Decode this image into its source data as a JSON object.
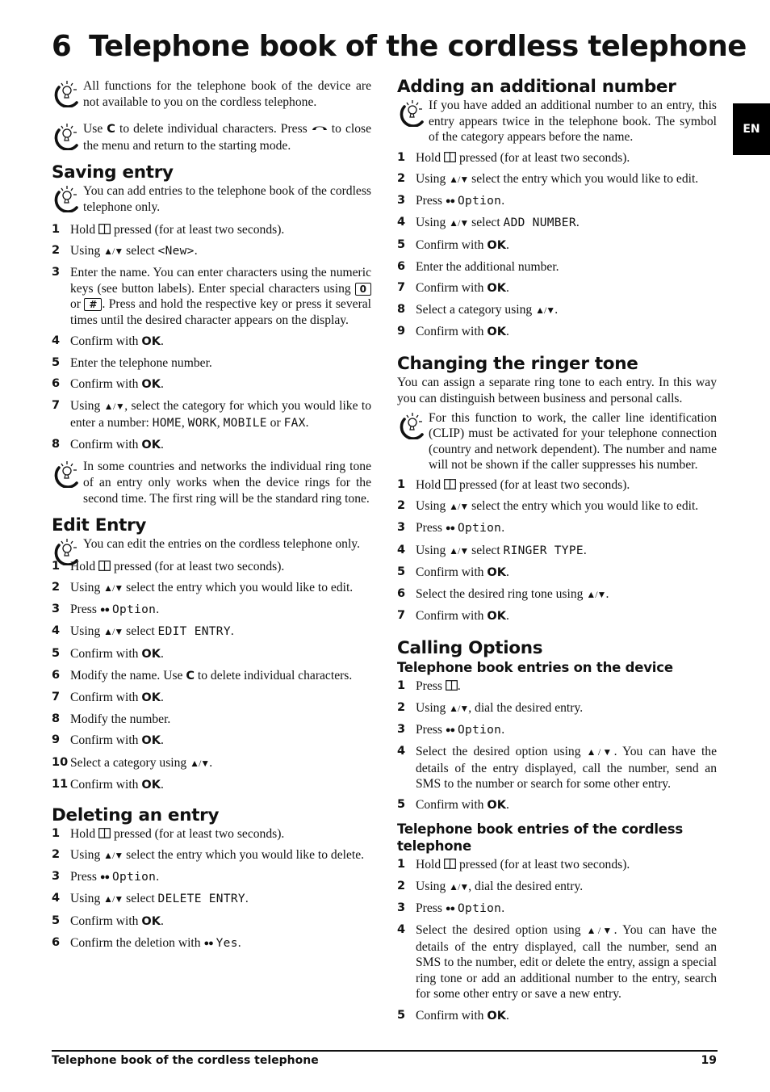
{
  "chapter": {
    "number": "6",
    "title": "Telephone book of the cordless telephone"
  },
  "language_tab": "EN",
  "icons": {
    "tip": "lightbulb-tip-icon",
    "phonebook": "phonebook-icon",
    "arrows": "up-down-arrows",
    "end_call": "end-call-icon",
    "softkey": "softkey-dots"
  },
  "glyphs": {
    "arrows": "▲/▼",
    "dots": "●●"
  },
  "intro_tips": [
    "All functions for the telephone book of the device are not available to you on the cordless telephone.",
    {
      "pre": "Use ",
      "key": "C",
      "mid": " to delete individual characters. Press ",
      "post": " to close the menu and return to the starting mode."
    }
  ],
  "saving_entry": {
    "heading": "Saving entry",
    "tip": "You can add entries to the telephone book of the cordless telephone only.",
    "steps": {
      "s1": {
        "n": "1",
        "pre": "Hold ",
        "post": " pressed (for at least two seconds)."
      },
      "s2": {
        "n": "2",
        "pre": "Using ",
        "mid": " select ",
        "lcd": "<New>",
        "post": "."
      },
      "s3": {
        "n": "3",
        "a": "Enter the name. You can enter characters using the numeric keys (see button labels).  Enter special characters using ",
        "k1": "0",
        "b": " or ",
        "k2": "#",
        "c": ". Press and hold the respective key or press it several times until the desired character appears on the display."
      },
      "s4": {
        "n": "4",
        "pre": "Confirm with ",
        "kb": "OK",
        "post": "."
      },
      "s5": {
        "n": "5",
        "text": "Enter the telephone number."
      },
      "s6": {
        "n": "6",
        "pre": "Confirm with ",
        "kb": "OK",
        "post": "."
      },
      "s7": {
        "n": "7",
        "pre": "Using ",
        "mid": ", select the category for which you would like to enter a number: ",
        "c1": "HOME",
        "c2": "WORK",
        "c3": "MOBILE",
        "or": " or ",
        "c4": "FAX",
        "post": "."
      },
      "s8": {
        "n": "8",
        "pre": "Confirm with ",
        "kb": "OK",
        "post": "."
      }
    },
    "tip2": "In some countries and networks the individual ring tone of an entry only works when the device rings for the second time. The first ring will be the standard ring tone."
  },
  "edit_entry": {
    "heading": "Edit Entry",
    "tip": "You can edit the entries on the cordless telephone only.",
    "steps": {
      "s1": {
        "n": "1",
        "pre": "Hold ",
        "post": " pressed (for at least two seconds)."
      },
      "s2": {
        "n": "2",
        "pre": "Using ",
        "post": " select the entry which you would like to edit."
      },
      "s3": {
        "n": "3",
        "pre": "Press ",
        "lcd": "Option",
        "post": "."
      },
      "s4": {
        "n": "4",
        "pre": "Using ",
        "mid": " select ",
        "lcd": "EDIT ENTRY",
        "post": "."
      },
      "s5": {
        "n": "5",
        "pre": "Confirm with ",
        "kb": "OK",
        "post": "."
      },
      "s6": {
        "n": "6",
        "pre": "Modify the name. Use ",
        "kb": "C",
        "post": " to delete individual characters."
      },
      "s7": {
        "n": "7",
        "pre": "Confirm with ",
        "kb": "OK",
        "post": "."
      },
      "s8": {
        "n": "8",
        "text": "Modify the number."
      },
      "s9": {
        "n": "9",
        "pre": "Confirm with ",
        "kb": "OK",
        "post": "."
      },
      "s10": {
        "n": "10",
        "pre": "Select a category using ",
        "post": "."
      },
      "s11": {
        "n": "11",
        "pre": "Confirm with ",
        "kb": "OK",
        "post": "."
      }
    }
  },
  "deleting_entry": {
    "heading": "Deleting an entry",
    "steps": {
      "s1": {
        "n": "1",
        "pre": "Hold ",
        "post": " pressed (for at least two seconds)."
      },
      "s2": {
        "n": "2",
        "pre": "Using ",
        "post": " select the entry which you would like to delete."
      },
      "s3": {
        "n": "3",
        "pre": "Press ",
        "lcd": "Option",
        "post": "."
      },
      "s4": {
        "n": "4",
        "pre": "Using ",
        "mid": " select ",
        "lcd": "DELETE ENTRY",
        "post": "."
      },
      "s5": {
        "n": "5",
        "pre": "Confirm with ",
        "kb": "OK",
        "post": "."
      },
      "s6": {
        "n": "6",
        "pre": "Confirm the deletion with ",
        "lcd": "Yes",
        "post": "."
      }
    }
  },
  "adding_number": {
    "heading": "Adding an additional number",
    "tip": "If you have added an additional number to an entry, this entry appears twice in the telephone book. The symbol of the category appears before the name.",
    "steps": {
      "s1": {
        "n": "1",
        "pre": "Hold ",
        "post": " pressed (for at least two seconds)."
      },
      "s2": {
        "n": "2",
        "pre": "Using ",
        "post": " select the entry which you would like to edit."
      },
      "s3": {
        "n": "3",
        "pre": "Press ",
        "lcd": "Option",
        "post": "."
      },
      "s4": {
        "n": "4",
        "pre": "Using ",
        "mid": " select ",
        "lcd": "ADD NUMBER",
        "post": "."
      },
      "s5": {
        "n": "5",
        "pre": "Confirm with ",
        "kb": "OK",
        "post": "."
      },
      "s6": {
        "n": "6",
        "text": "Enter the additional number."
      },
      "s7": {
        "n": "7",
        "pre": "Confirm with ",
        "kb": "OK",
        "post": "."
      },
      "s8": {
        "n": "8",
        "pre": "Select a category using ",
        "post": "."
      },
      "s9": {
        "n": "9",
        "pre": "Confirm with ",
        "kb": "OK",
        "post": "."
      }
    }
  },
  "ringer_tone": {
    "heading": "Changing the ringer tone",
    "intro": "You can assign a separate ring tone to each entry. In this way you can distinguish between business and personal calls.",
    "tip": "For this function to work, the caller line identification (CLIP) must be activated for your telephone connection (country and network dependent). The number and name will not be shown if the caller suppresses his number.",
    "steps": {
      "s1": {
        "n": "1",
        "pre": "Hold ",
        "post": " pressed (for at least two seconds)."
      },
      "s2": {
        "n": "2",
        "pre": "Using ",
        "post": " select the entry which you would like to edit."
      },
      "s3": {
        "n": "3",
        "pre": "Press ",
        "lcd": "Option",
        "post": "."
      },
      "s4": {
        "n": "4",
        "pre": "Using ",
        "mid": " select ",
        "lcd": "RINGER TYPE",
        "post": "."
      },
      "s5": {
        "n": "5",
        "pre": "Confirm with ",
        "kb": "OK",
        "post": "."
      },
      "s6": {
        "n": "6",
        "pre": "Select the desired ring tone using ",
        "post": "."
      },
      "s7": {
        "n": "7",
        "pre": "Confirm with ",
        "kb": "OK",
        "post": "."
      }
    }
  },
  "calling_options": {
    "heading": "Calling Options",
    "device": {
      "subheading": "Telephone book entries on the device",
      "steps": {
        "s1": {
          "n": "1",
          "pre": "Press ",
          "post": "."
        },
        "s2": {
          "n": "2",
          "pre": "Using ",
          "post": ", dial the desired entry."
        },
        "s3": {
          "n": "3",
          "pre": "Press ",
          "lcd": "Option",
          "post": "."
        },
        "s4": {
          "n": "4",
          "pre": "Select the desired option using ",
          "post": ". You can have the details of the entry displayed, call the number, send an SMS to the number or search for some other entry."
        },
        "s5": {
          "n": "5",
          "pre": "Confirm with ",
          "kb": "OK",
          "post": "."
        }
      }
    },
    "cordless": {
      "subheading": "Telephone book entries of the cordless telephone",
      "steps": {
        "s1": {
          "n": "1",
          "pre": "Hold ",
          "post": " pressed (for at least two seconds)."
        },
        "s2": {
          "n": "2",
          "pre": "Using ",
          "post": ", dial the desired entry."
        },
        "s3": {
          "n": "3",
          "pre": "Press ",
          "lcd": "Option",
          "post": "."
        },
        "s4": {
          "n": "4",
          "pre": "Select the desired option using ",
          "post": ". You can have the details of the entry displayed, call the number, send an SMS to the number, edit or delete the entry, assign a special ring tone or add an additional number to the entry, search for some other entry or save a new entry."
        },
        "s5": {
          "n": "5",
          "pre": "Confirm with ",
          "kb": "OK",
          "post": "."
        }
      }
    }
  },
  "footer": {
    "section": "Telephone book of the cordless telephone",
    "page": "19"
  }
}
